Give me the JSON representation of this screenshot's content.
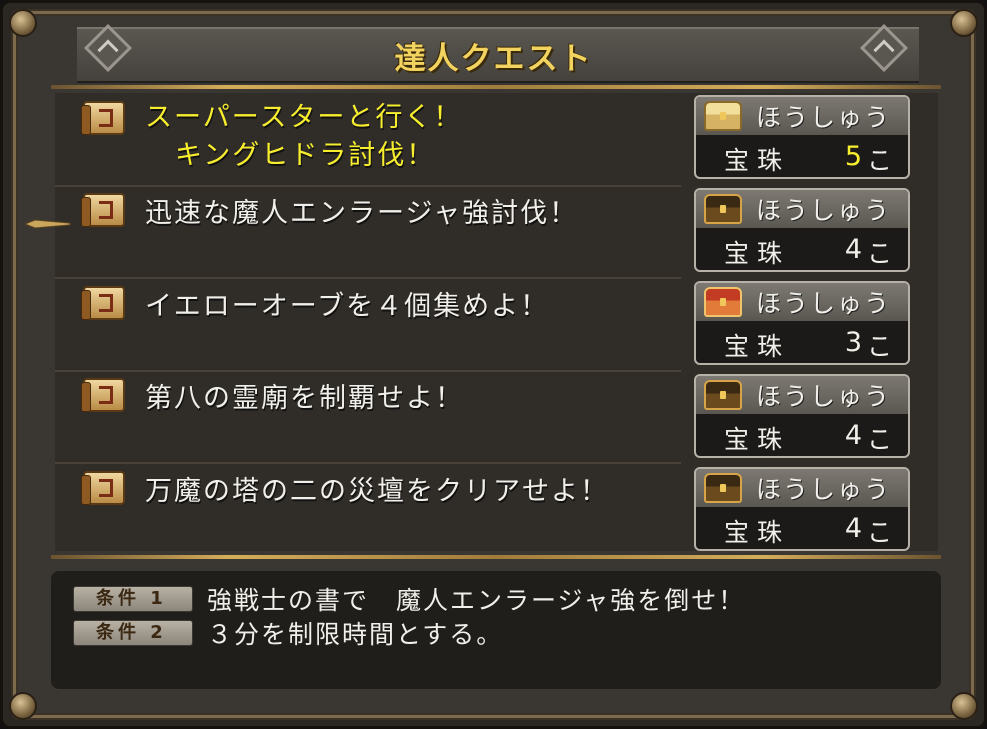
{
  "title": "達人クエスト",
  "quests": [
    {
      "line1": "スーパースターと行く！",
      "line2": "キングヒドラ討伐！",
      "highlight": true,
      "reward": {
        "label": "ほうしゅう",
        "item": "宝珠",
        "qty": "5",
        "unit": "こ",
        "chest": "gold"
      }
    },
    {
      "line1": "迅速な魔人エンラージャ強討伐！",
      "line2": "",
      "highlight": false,
      "reward": {
        "label": "ほうしゅう",
        "item": "宝珠",
        "qty": "4",
        "unit": "こ",
        "chest": "dark"
      }
    },
    {
      "line1": "イエローオーブを４個集めよ！",
      "line2": "",
      "highlight": false,
      "reward": {
        "label": "ほうしゅう",
        "item": "宝珠",
        "qty": "3",
        "unit": "こ",
        "chest": "red"
      }
    },
    {
      "line1": "第八の霊廟を制覇せよ！",
      "line2": "",
      "highlight": false,
      "reward": {
        "label": "ほうしゅう",
        "item": "宝珠",
        "qty": "4",
        "unit": "こ",
        "chest": "dark"
      }
    },
    {
      "line1": "万魔の塔の二の災壇をクリアせよ！",
      "line2": "",
      "highlight": false,
      "reward": {
        "label": "ほうしゅう",
        "item": "宝珠",
        "qty": "4",
        "unit": "こ",
        "chest": "dark"
      }
    }
  ],
  "conditions": [
    {
      "badge": "条件 1",
      "text": "強戦士の書で　魔人エンラージャ強を倒せ！"
    },
    {
      "badge": "条件 2",
      "text": "３分を制限時間とする。"
    }
  ],
  "colors": {
    "highlight": "#f7ee2e",
    "title": "#f3d35f",
    "text": "#f1efe9"
  }
}
